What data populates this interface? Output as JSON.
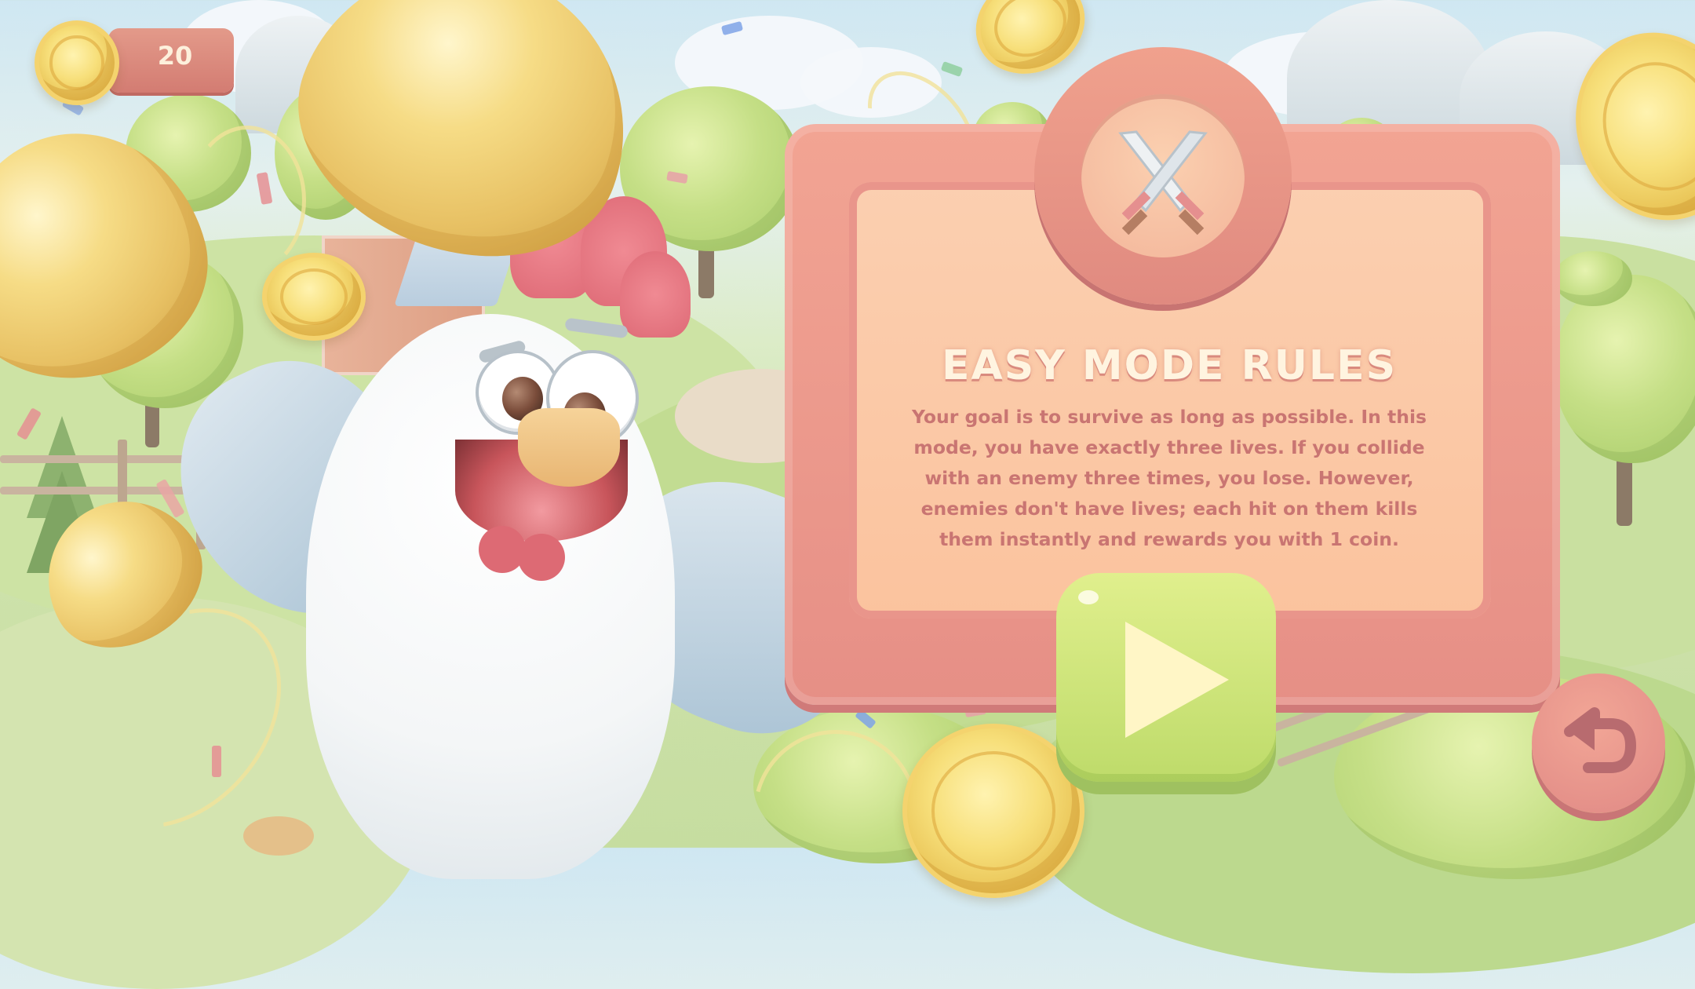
{
  "hud": {
    "coin_count": "20",
    "coin_icon": "gold-coin-icon"
  },
  "rules_panel": {
    "title": "EASY MODE RULES",
    "badge_icon": "crossed-swords-icon",
    "body": "Your goal is to survive as long as possible. In this mode, you have exactly three lives. If you collide with an enemy three times, you lose. However, enemies don't have lives; each hit on them kills them instantly and rewards you with 1 coin."
  },
  "buttons": {
    "play_icon": "play-icon",
    "back_icon": "back-arrow-icon"
  },
  "colors": {
    "panel": "#e8958a",
    "panel_inner": "#fbc9a6",
    "title_text": "#fff4e0",
    "body_text": "#c97572",
    "play_button": "#cde57a",
    "back_button": "#e6908a",
    "coin": "#f0cf6a"
  }
}
